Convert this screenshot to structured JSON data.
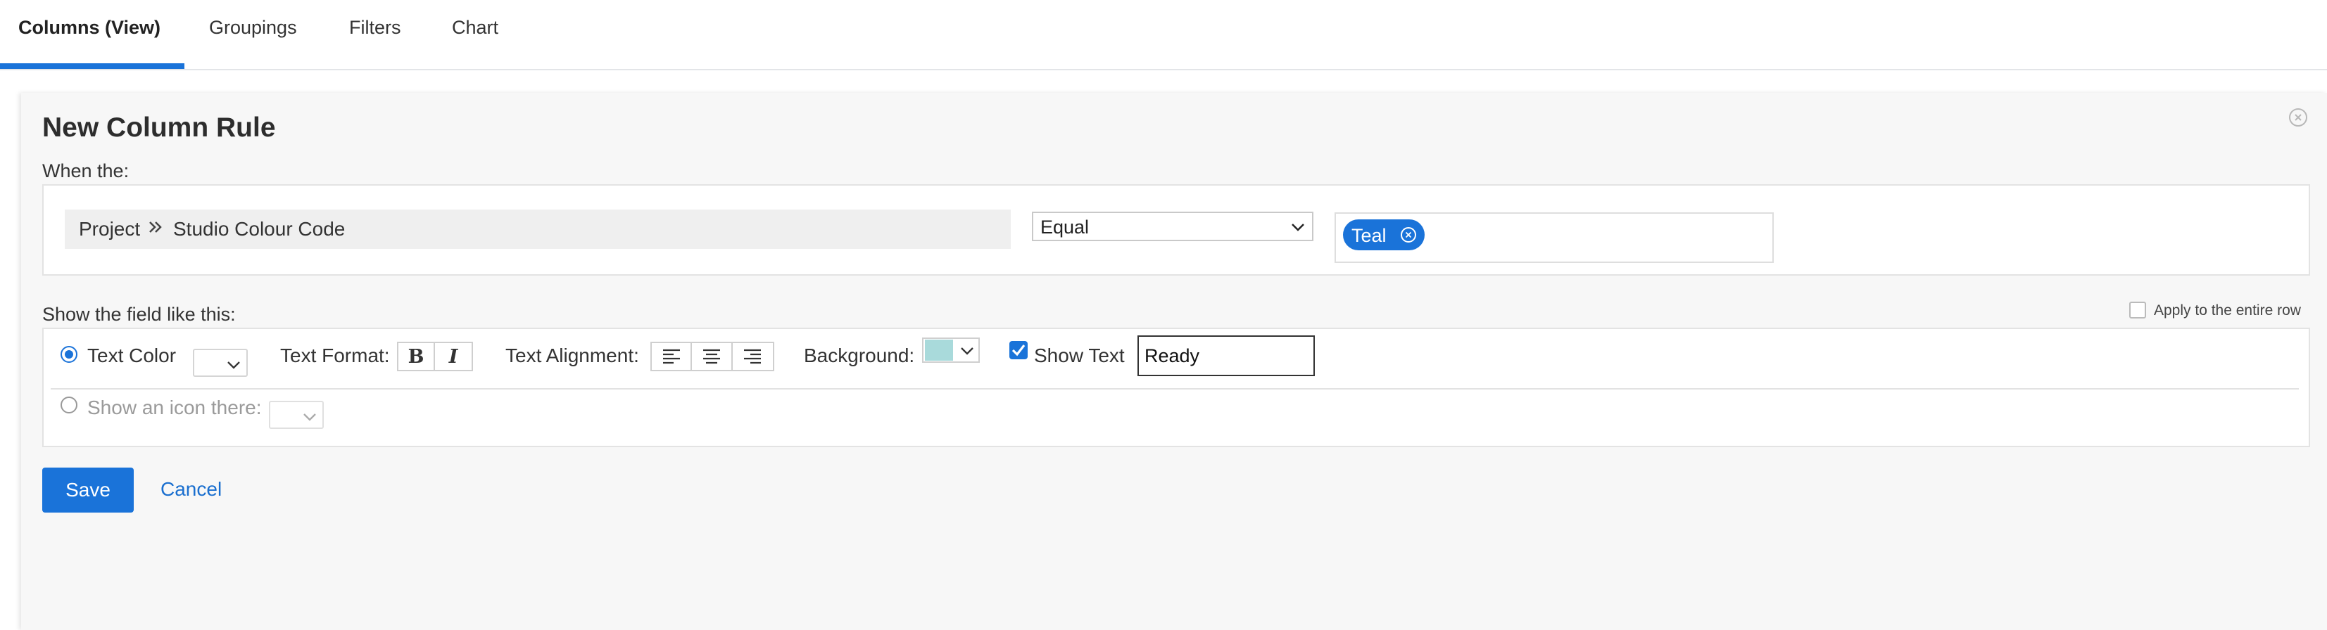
{
  "tabs": [
    {
      "label": "Columns (View)",
      "active": true
    },
    {
      "label": "Groupings",
      "active": false
    },
    {
      "label": "Filters",
      "active": false
    },
    {
      "label": "Chart",
      "active": false
    }
  ],
  "panel": {
    "title": "New Column Rule",
    "when_label": "When the:",
    "condition": {
      "field_path": [
        "Project",
        "Studio Colour Code"
      ],
      "operator": "Equal",
      "value_chip": "Teal"
    },
    "show_label": "Show the field like this:",
    "apply_entire_row": {
      "label": "Apply to the entire row",
      "checked": false
    },
    "format": {
      "text_color_label": "Text Color",
      "text_color_selected": true,
      "text_format_label": "Text Format:",
      "bold_glyph": "B",
      "italic_glyph": "I",
      "text_alignment_label": "Text Alignment:",
      "background_label": "Background:",
      "background_color": "#a9dadb",
      "show_text_label": "Show Text",
      "show_text_checked": true,
      "show_text_value": "Ready",
      "show_icon_label": "Show an icon there:",
      "show_icon_selected": false
    },
    "save_label": "Save",
    "cancel_label": "Cancel"
  },
  "colors": {
    "accent": "#1a73d9",
    "panel_bg": "#f7f7f7",
    "link": "#1a6fcf"
  }
}
